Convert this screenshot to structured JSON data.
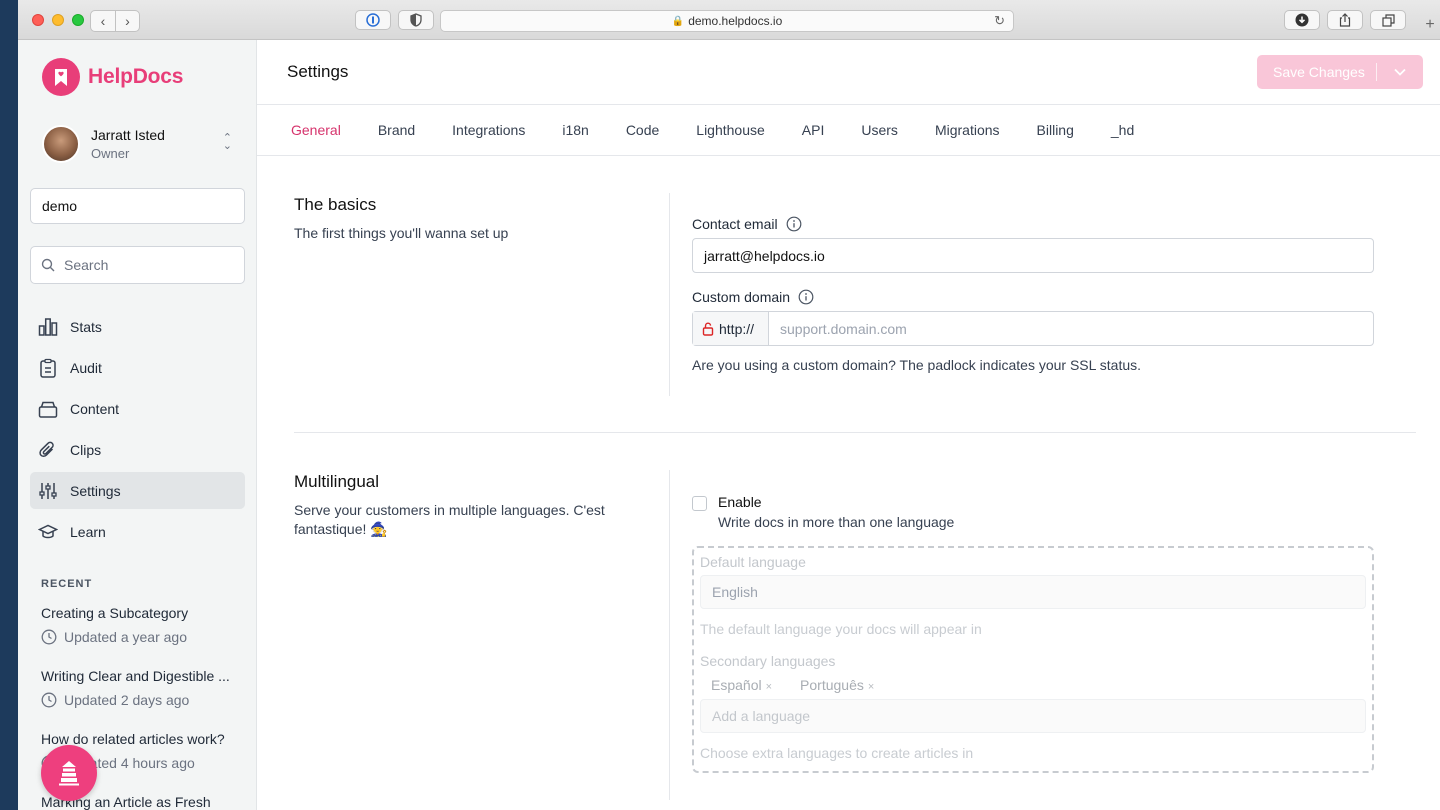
{
  "browser": {
    "url": "demo.helpdocs.io"
  },
  "brand": {
    "name": "HelpDocs",
    "color": "#e83e79"
  },
  "user": {
    "name": "Jarratt Isted",
    "role": "Owner"
  },
  "site_input": {
    "value": "demo"
  },
  "search": {
    "placeholder": "Search"
  },
  "nav": [
    {
      "label": "Stats",
      "icon": "chart-bar-icon"
    },
    {
      "label": "Audit",
      "icon": "clipboard-icon"
    },
    {
      "label": "Content",
      "icon": "archive-box-icon"
    },
    {
      "label": "Clips",
      "icon": "paperclip-icon"
    },
    {
      "label": "Settings",
      "icon": "sliders-icon",
      "active": true
    },
    {
      "label": "Learn",
      "icon": "graduation-cap-icon"
    }
  ],
  "recent": {
    "heading": "RECENT",
    "items": [
      {
        "title": "Creating a Subcategory",
        "meta": "Updated a year ago"
      },
      {
        "title": "Writing Clear and Digestible ...",
        "meta": "Updated 2 days ago"
      },
      {
        "title": "How do related articles work?",
        "meta": "Updated 4 hours ago"
      },
      {
        "title": "Marking an Article as Fresh",
        "meta": ""
      }
    ]
  },
  "header": {
    "title": "Settings",
    "save_label": "Save Changes"
  },
  "tabs": [
    {
      "label": "General",
      "active": true
    },
    {
      "label": "Brand"
    },
    {
      "label": "Integrations"
    },
    {
      "label": "i18n"
    },
    {
      "label": "Code"
    },
    {
      "label": "Lighthouse"
    },
    {
      "label": "API"
    },
    {
      "label": "Users"
    },
    {
      "label": "Migrations"
    },
    {
      "label": "Billing"
    },
    {
      "label": "_hd"
    }
  ],
  "basics": {
    "title": "The basics",
    "description": "The first things you'll wanna set up",
    "contact_email_label": "Contact email",
    "contact_email_value": "jarratt@helpdocs.io",
    "custom_domain_label": "Custom domain",
    "custom_domain_prefix": "http://",
    "custom_domain_placeholder": "support.domain.com",
    "custom_domain_help": "Are you using a custom domain? The padlock indicates your SSL status."
  },
  "multilingual": {
    "title": "Multilingual",
    "description": "Serve your customers in multiple languages. C'est fantastique! 🧙",
    "enable_label": "Enable",
    "enable_desc": "Write docs in more than one language",
    "enabled": false,
    "default_language_label": "Default language",
    "default_language_value": "English",
    "default_language_help": "The default language your docs will appear in",
    "secondary_languages_label": "Secondary languages",
    "secondary_languages": [
      "Español",
      "Português"
    ],
    "add_language_placeholder": "Add a language",
    "secondary_languages_help": "Choose extra languages to create articles in"
  }
}
